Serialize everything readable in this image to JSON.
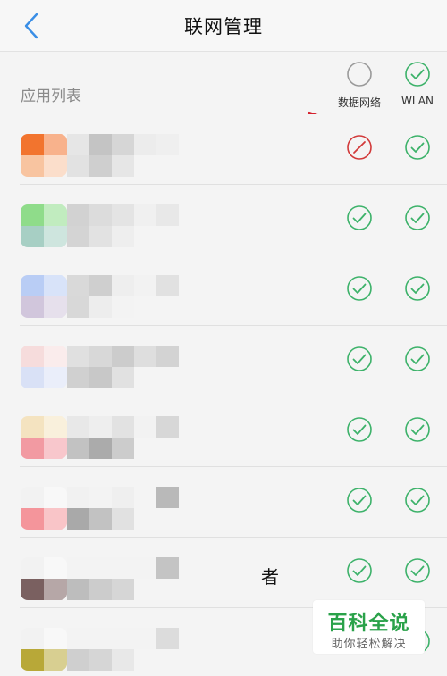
{
  "nav": {
    "title": "联网管理",
    "back_icon": "chevron-left-icon"
  },
  "list_header": {
    "label": "应用列表",
    "mobile_data": {
      "label": "数据网络",
      "state": "unchecked"
    },
    "wlan": {
      "label": "WLAN",
      "state": "checked"
    }
  },
  "apps": [
    {
      "mobile_data": "blocked",
      "wlan": "allowed",
      "icon_colors": [
        "#f2742e",
        "#f8c4a0"
      ],
      "blur": [
        "#e6e6e6",
        "#c4c4c4",
        "#d6d6d6",
        "#ececec",
        "#efefef",
        "#e2e2e2",
        "#cfcfcf",
        "#e6e6e6"
      ]
    },
    {
      "mobile_data": "allowed",
      "wlan": "allowed",
      "icon_colors": [
        "#8fdc8a",
        "#a7cfc4"
      ],
      "blur": [
        "#d2d2d2",
        "#dcdcdc",
        "#e4e4e4",
        "#f0f0f0",
        "#e8e8e8",
        "#d4d4d4",
        "#e2e2e2",
        "#eeeeee"
      ]
    },
    {
      "mobile_data": "allowed",
      "wlan": "allowed",
      "icon_colors": [
        "#b9cdf5",
        "#d1c6dc"
      ],
      "blur": [
        "#d9d9d9",
        "#cfcfcf",
        "#eeeeee",
        "#f2f2f2",
        "#e1e1e1",
        "#d8d8d8",
        "#ededed",
        "#f3f3f3"
      ]
    },
    {
      "mobile_data": "allowed",
      "wlan": "allowed",
      "icon_colors": [
        "#f6dcdc",
        "#d9e1f6"
      ],
      "blur": [
        "#e0e0e0",
        "#d8d8d8",
        "#cccccc",
        "#dedede",
        "#d3d3d3",
        "#d0d0d0",
        "#c8c8c8",
        "#e1e1e1"
      ]
    },
    {
      "mobile_data": "allowed",
      "wlan": "allowed",
      "icon_colors": [
        "#f4e3c0",
        "#f29aa2"
      ],
      "blur": [
        "#e8e8e8",
        "#eeeeee",
        "#e2e2e2",
        "#f2f2f2",
        "#d7d7d7",
        "#c2c2c2",
        "#ababab",
        "#cccccc"
      ]
    },
    {
      "mobile_data": "allowed",
      "wlan": "allowed",
      "icon_colors": [
        "#f2f2f2",
        "#f4959b"
      ],
      "blur": [
        "#f1f1f1",
        "#f3f3f3",
        "#efefef",
        "#f4f4f4",
        "#b9b9b9",
        "#a9a9a9",
        "#c2c2c2",
        "#e1e1e1"
      ]
    },
    {
      "mobile_data": "allowed",
      "wlan": "allowed",
      "icon_colors": [
        "#f2f2f2",
        "#7a6060"
      ],
      "blur": [
        "#f3f3f3",
        "#f3f3f3",
        "#f3f3f3",
        "#f3f3f3",
        "#c4c4c4",
        "#bdbdbd",
        "#cccccc",
        "#d6d6d6"
      ],
      "name_tail": "者"
    },
    {
      "mobile_data": "allowed",
      "wlan": "allowed",
      "icon_colors": [
        "#f2f2f2",
        "#b8a838"
      ],
      "blur": [
        "#f3f3f3",
        "#f3f3f3",
        "#f3f3f3",
        "#f3f3f3",
        "#dcdcdc",
        "#cfcfcf",
        "#d6d6d6",
        "#e8e8e8"
      ]
    }
  ],
  "watermark": {
    "title": "百科全说",
    "subtitle": "助你轻松解决"
  },
  "colors": {
    "accent_green": "#3db26a",
    "blocked_red": "#d23a3a",
    "annotation_red": "#d4202c",
    "inactive_gray": "#9a9a9a"
  }
}
